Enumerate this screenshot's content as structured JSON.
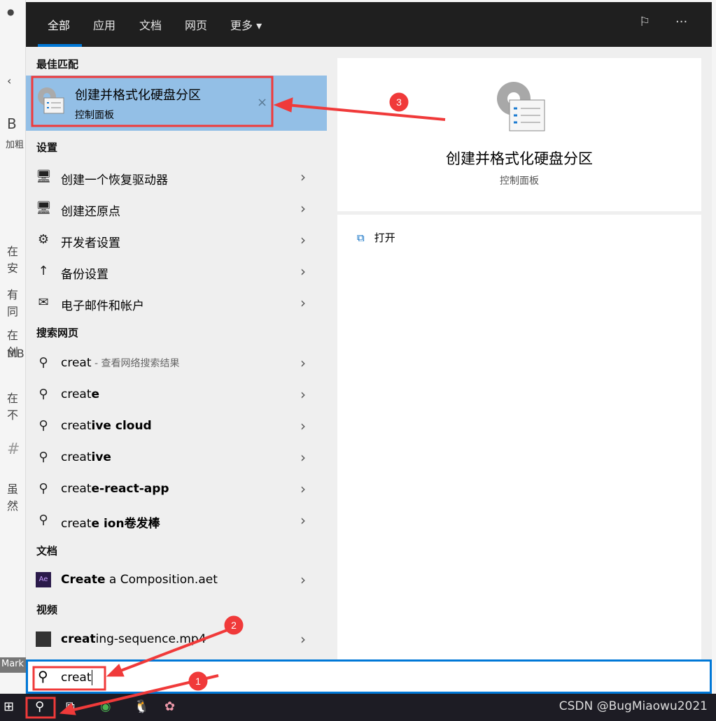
{
  "background": {
    "left_fragments": [
      "在安",
      "有同",
      "在创",
      "MB",
      "在不",
      "#",
      "虽然",
      "加粗",
      "B"
    ],
    "mark_label": "Mark"
  },
  "header": {
    "tabs": [
      {
        "label": "全部",
        "active": true
      },
      {
        "label": "应用"
      },
      {
        "label": "文档"
      },
      {
        "label": "网页"
      },
      {
        "label": "更多 ▾"
      }
    ],
    "feedback_icon": "feedback-icon",
    "more_icon": "···"
  },
  "best_match": {
    "section": "最佳匹配",
    "title": "创建并格式化硬盘分区",
    "subtitle": "控制面板",
    "close": "×"
  },
  "settings": {
    "section": "设置",
    "items": [
      {
        "label": "创建一个恢复驱动器",
        "icon": "🖥"
      },
      {
        "label": "创建还原点",
        "icon": "🖥"
      },
      {
        "label": "开发者设置",
        "icon": "⚙"
      },
      {
        "label": "备份设置",
        "icon": "↑"
      },
      {
        "label": "电子邮件和帐户",
        "icon": "✉"
      }
    ]
  },
  "web": {
    "section": "搜索网页",
    "items": [
      {
        "pre": "creat",
        "bold": "",
        "hint": " - 查看网络搜索结果"
      },
      {
        "pre": "creat",
        "bold": "e"
      },
      {
        "pre": "creat",
        "bold": "ive cloud"
      },
      {
        "pre": "creat",
        "bold": "ive"
      },
      {
        "pre": "creat",
        "bold": "e-react-app"
      },
      {
        "pre": "creat",
        "bold": "e ion卷发棒"
      }
    ]
  },
  "docs": {
    "section": "文档",
    "item": {
      "bold": "Create",
      "rest": " a Composition.aet",
      "icon": "Ae"
    }
  },
  "videos": {
    "section": "视频",
    "item": {
      "bold": "creat",
      "rest": "ing-sequence.mp4"
    }
  },
  "preview": {
    "title": "创建并格式化硬盘分区",
    "subtitle": "控制面板",
    "open": "打开"
  },
  "search": {
    "value": "creat"
  },
  "taskbar": {
    "watermark": "CSDN @BugMiaowu2021"
  },
  "annotations": {
    "labels": [
      "1",
      "2",
      "3"
    ],
    "color": "#f03a3a"
  }
}
